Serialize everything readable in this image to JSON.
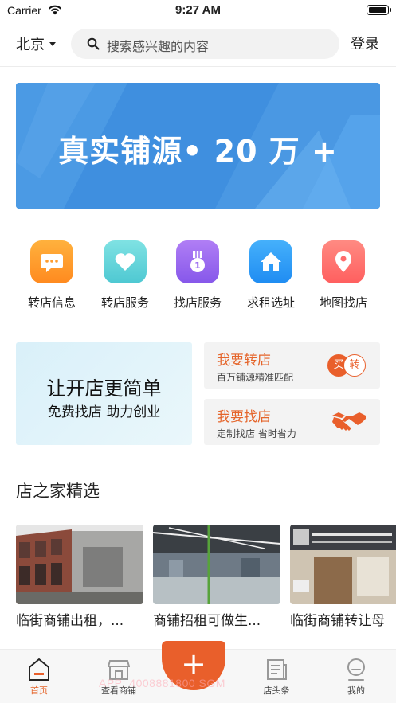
{
  "status_bar": {
    "carrier": "Carrier",
    "time": "9:27 AM"
  },
  "header": {
    "city": "北京",
    "search_placeholder": "搜索感兴趣的内容",
    "login_label": "登录"
  },
  "banner": {
    "text": "真实铺源• 20 万 +",
    "color": "#3f8fdf"
  },
  "categories": [
    {
      "label": "转店信息",
      "icon": "message-icon",
      "color": "#ff9d2e"
    },
    {
      "label": "转店服务",
      "icon": "heart-icon",
      "color": "#5ed3d8"
    },
    {
      "label": "找店服务",
      "icon": "medal-icon",
      "color": "#9b6cf0"
    },
    {
      "label": "求租选址",
      "icon": "home-icon",
      "color": "#2d9af7"
    },
    {
      "label": "地图找店",
      "icon": "location-pin-icon",
      "color": "#ff6b6b"
    }
  ],
  "promo": {
    "title": "让开店更简单",
    "subtitle": "免费找店 助力创业",
    "transfer": {
      "title": "我要转店",
      "subtitle": "百万铺源精准匹配",
      "buy": "买",
      "sell": "转"
    },
    "find": {
      "title": "我要找店",
      "subtitle": "定制找店 省时省力",
      "icon": "handshake-icon"
    }
  },
  "section": {
    "title": "店之家精选",
    "listings": [
      {
        "title": "临街商铺出租，..."
      },
      {
        "title": "商铺招租可做生..."
      },
      {
        "title": "临街商铺转让母"
      }
    ]
  },
  "tabbar": {
    "tabs": [
      {
        "label": "首页",
        "icon": "home-tab-icon",
        "active": true
      },
      {
        "label": "查看商铺",
        "icon": "store-icon",
        "active": false
      },
      {
        "label": "店头条",
        "icon": "news-icon",
        "active": false
      },
      {
        "label": "我的",
        "icon": "profile-icon",
        "active": false
      }
    ],
    "fab": "+",
    "watermark": "APP: 4008881800 SGM",
    "accent": "#e95f2b"
  }
}
